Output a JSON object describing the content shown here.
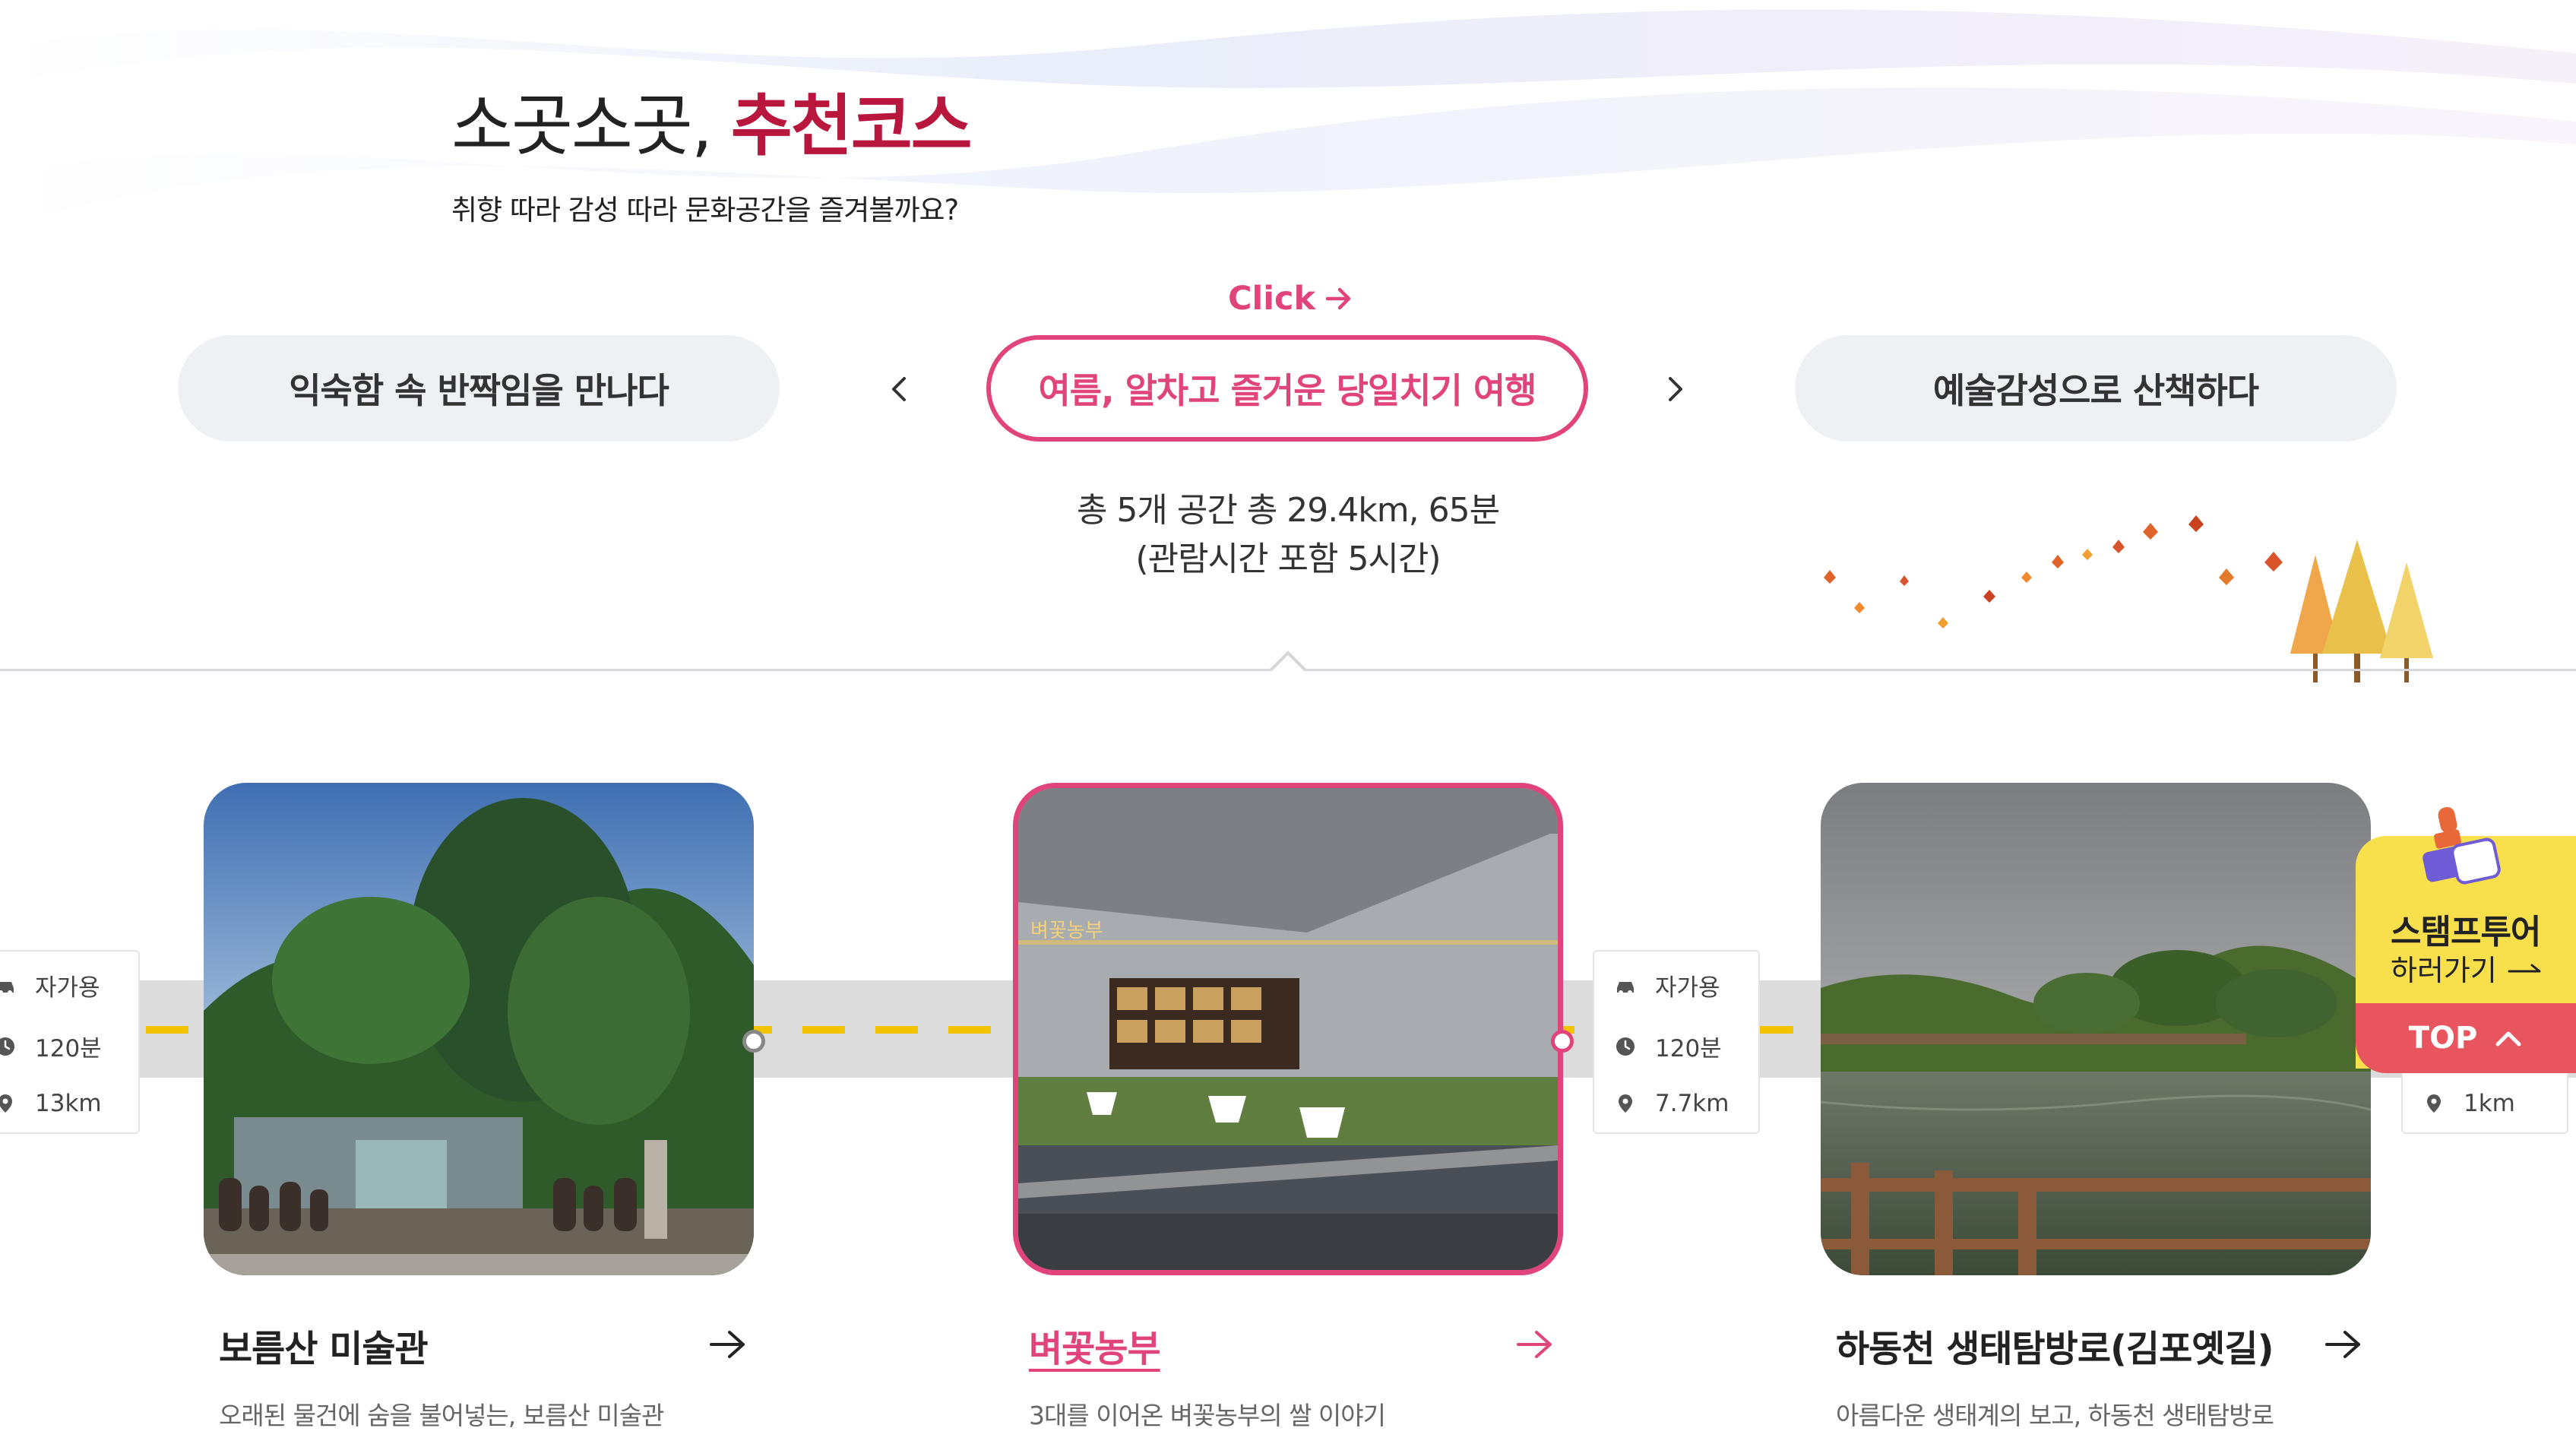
{
  "heading": {
    "prefix": "소곳소곳, ",
    "highlight": "추천코스"
  },
  "subheading": "취향 따라 감성 따라 문화공간을 즐겨볼까요?",
  "click_hint": "Click",
  "courses": [
    {
      "label": "익숙함 속 반짝임을 만나다"
    },
    {
      "label": "여름, 알차고 즐거운 당일치기 여행"
    },
    {
      "label": "예술감성으로 산책하다"
    }
  ],
  "summary": {
    "line1": "총 5개 공간 총 29.4km, 65분",
    "line2": "(관람시간 포함 5시간)"
  },
  "places": [
    {
      "title": "보름산 미술관",
      "desc": "오래된 물건에 숨을 불어넣는, 보름산 미술관"
    },
    {
      "title": "벼꽃농부",
      "desc": "3대를 이어온 벼꽃농부의 쌀 이야기"
    },
    {
      "title": "하동천 생태탐방로(김포옛길)",
      "desc": "아름다운 생태계의 보고, 하동천 생태탐방로"
    }
  ],
  "routes": [
    {
      "mode": "자가용",
      "time": "120분",
      "distance": "13km"
    },
    {
      "mode": "자가용",
      "time": "120분",
      "distance": "7.7km"
    },
    {
      "distance": "1km"
    }
  ],
  "sign_text": "벼꽃농부",
  "stamp": {
    "title": "스탬프투어",
    "sub": "하러가기"
  },
  "top_label": "TOP",
  "colors": {
    "accent": "#e0447a",
    "brand": "#b8163d",
    "stamp": "#f8df4c",
    "top": "#e8555f"
  },
  "icons": [
    "car-icon",
    "clock-icon",
    "pin-icon",
    "arrow-right-icon",
    "chevron-left-icon",
    "chevron-right-icon",
    "stamp-icon",
    "chevron-up-icon"
  ]
}
